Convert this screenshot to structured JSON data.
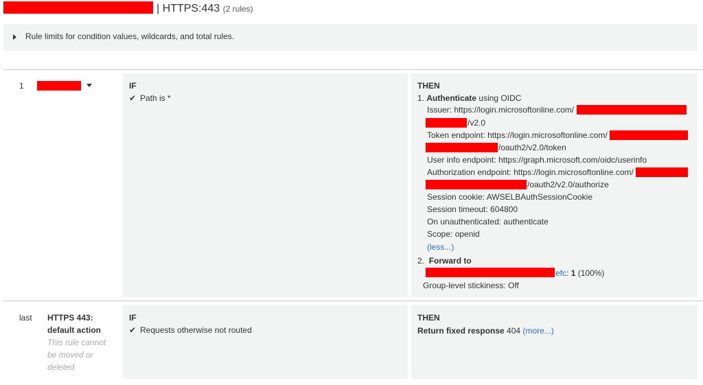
{
  "header": {
    "title": "| HTTPS:443",
    "rule_count": "(2 rules)"
  },
  "limits": {
    "label": "Rule limits for condition values, wildcards, and total rules."
  },
  "rule1": {
    "number": "1",
    "if_heading": "IF",
    "condition": "Path is *",
    "then_heading": "THEN",
    "auth_index": "1.",
    "auth_label": "Authenticate",
    "auth_suffix": "using OIDC",
    "issuer_label": "Issuer: https://login.microsoftonline.com/",
    "issuer_tail": "/v2.0",
    "token_label": "Token endpoint: https://login.microsoftonline.com/",
    "token_tail": "/oauth2/v2.0/token",
    "userinfo": "User info endpoint: https://graph.microsoft.com/oidc/userinfo",
    "authz_label": "Authorization endpoint: https://login.microsoftonline.com/",
    "authz_tail": "/oauth2/v2.0/authorize",
    "session_cookie": "Session cookie: AWSELBAuthSessionCookie",
    "session_timeout": "Session timeout: 604800",
    "on_unauth": "On unauthenticated: authenticate",
    "scope": "Scope: openid",
    "less_link": "(less...)",
    "forward_index": "2.",
    "forward_label": "Forward to",
    "target_tail": "efc",
    "target_weight_sep": ": ",
    "target_weight": "1",
    "target_pct": "(100%)",
    "stickiness": "Group-level stickiness: Off"
  },
  "rule_last": {
    "number": "last",
    "name_line1": "HTTPS 443:",
    "name_line2": "default action",
    "note_line1": "This rule cannot",
    "note_line2": "be moved or",
    "note_line3": "deleted",
    "if_heading": "IF",
    "condition": "Requests otherwise not routed",
    "then_heading": "THEN",
    "action_label": "Return fixed response",
    "action_value": "404",
    "more_link": "(more...)"
  },
  "colors": {
    "redaction": "#ff0000",
    "link": "#2a6ebb",
    "panel": "#f2f3f3"
  },
  "icons": {
    "check": "check-icon",
    "expand": "caret-right-icon",
    "dropdown": "caret-down-icon"
  }
}
